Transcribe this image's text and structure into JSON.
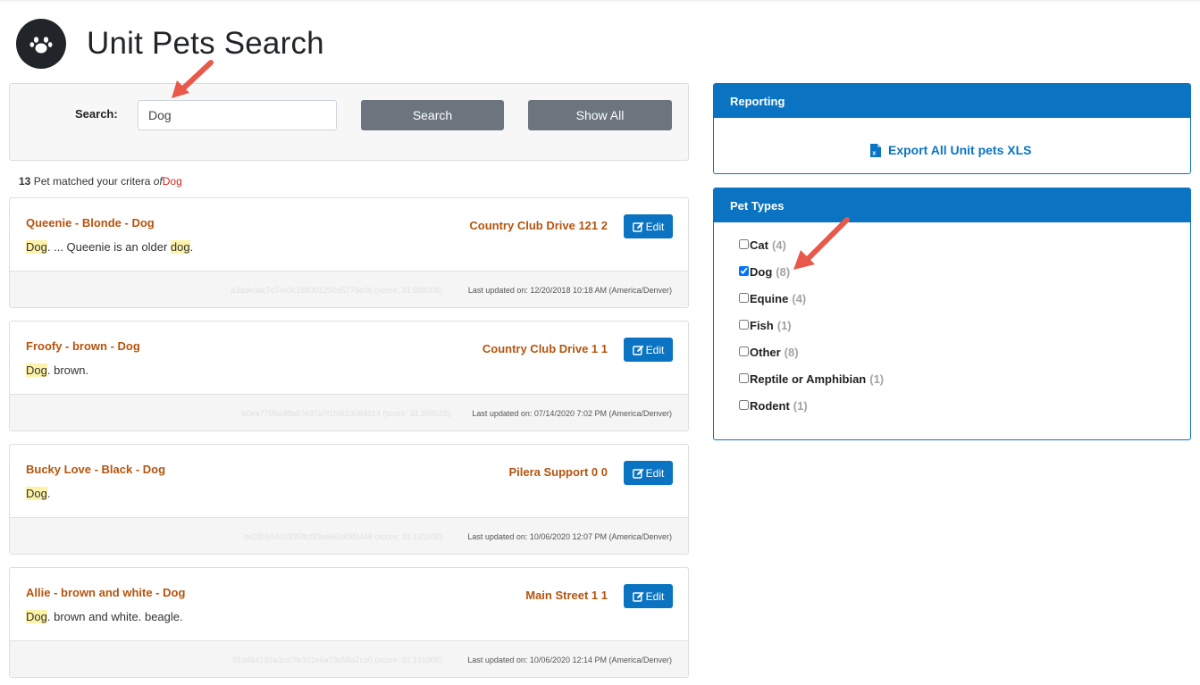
{
  "page": {
    "title": "Unit Pets Search"
  },
  "search": {
    "label": "Search:",
    "value": "Dog",
    "search_button": "Search",
    "show_all_button": "Show All"
  },
  "results_summary": {
    "count": "13",
    "text": " Pet matched your critera ",
    "of": "of",
    "term": "Dog"
  },
  "results": [
    {
      "title": "Queenie - Blonde - Dog",
      "snippet_highlight": "Dog",
      "snippet_middle": ". ... Queenie is an older ",
      "snippet_highlight2": "dog",
      "snippet_end": ".",
      "address": "Country Club Drive 121 2",
      "edit_label": "Edit",
      "hash": "a3ade0ac7c74e3c168301250d5779e06 (score: 31.588008)",
      "updated": "Last updated on: 12/20/2018 10:18 AM (America/Denver)"
    },
    {
      "title": "Froofy - brown - Dog",
      "snippet_highlight": "Dog",
      "snippet_middle": ". brown.",
      "snippet_highlight2": "",
      "snippet_end": "",
      "address": "Country Club Drive 1 1",
      "edit_label": "Edit",
      "hash": "b0ea7705a48a97e37a7f1f0623084914 (score: 31.399529)",
      "updated": "Last updated on: 07/14/2020 7:02 PM (America/Denver)"
    },
    {
      "title": "Bucky Love - Black - Dog",
      "snippet_highlight": "Dog",
      "snippet_middle": ".",
      "snippet_highlight2": "",
      "snippet_end": "",
      "address": "Pilera Support 0 0",
      "edit_label": "Edit",
      "hash": "be28c594019358cf93eb66d49f0446 (score: 31.131008)",
      "updated": "Last updated on: 10/06/2020 12:07 PM (America/Denver)"
    },
    {
      "title": "Allie - brown and white - Dog",
      "snippet_highlight": "Dog",
      "snippet_middle": ". brown and white. beagle.",
      "snippet_highlight2": "",
      "snippet_end": "",
      "address": "Main Street 1 1",
      "edit_label": "Edit",
      "hash": "91d464192a3cd7fe321e6a73e58a2ca0 (score: 31.131008)",
      "updated": "Last updated on: 10/06/2020 12:14 PM (America/Denver)"
    }
  ],
  "reporting": {
    "header": "Reporting",
    "export_label": "Export All Unit pets XLS"
  },
  "pet_types": {
    "header": "Pet Types",
    "items": [
      {
        "label": "Cat",
        "count": "(4)",
        "checked": false
      },
      {
        "label": "Dog",
        "count": "(8)",
        "checked": true
      },
      {
        "label": "Equine",
        "count": "(4)",
        "checked": false
      },
      {
        "label": "Fish",
        "count": "(1)",
        "checked": false
      },
      {
        "label": "Other",
        "count": "(8)",
        "checked": false
      },
      {
        "label": "Reptile or Amphibian",
        "count": "(1)",
        "checked": false
      },
      {
        "label": "Rodent",
        "count": "(1)",
        "checked": false
      }
    ]
  },
  "colors": {
    "accent_blue": "#0b74c2",
    "title_orange": "#b5540d",
    "highlight": "#fdf2a7",
    "grey_button": "#6c757d",
    "annotation_arrow": "#e8594a"
  },
  "icons": [
    "paw-icon",
    "edit-icon",
    "excel-file-icon"
  ]
}
